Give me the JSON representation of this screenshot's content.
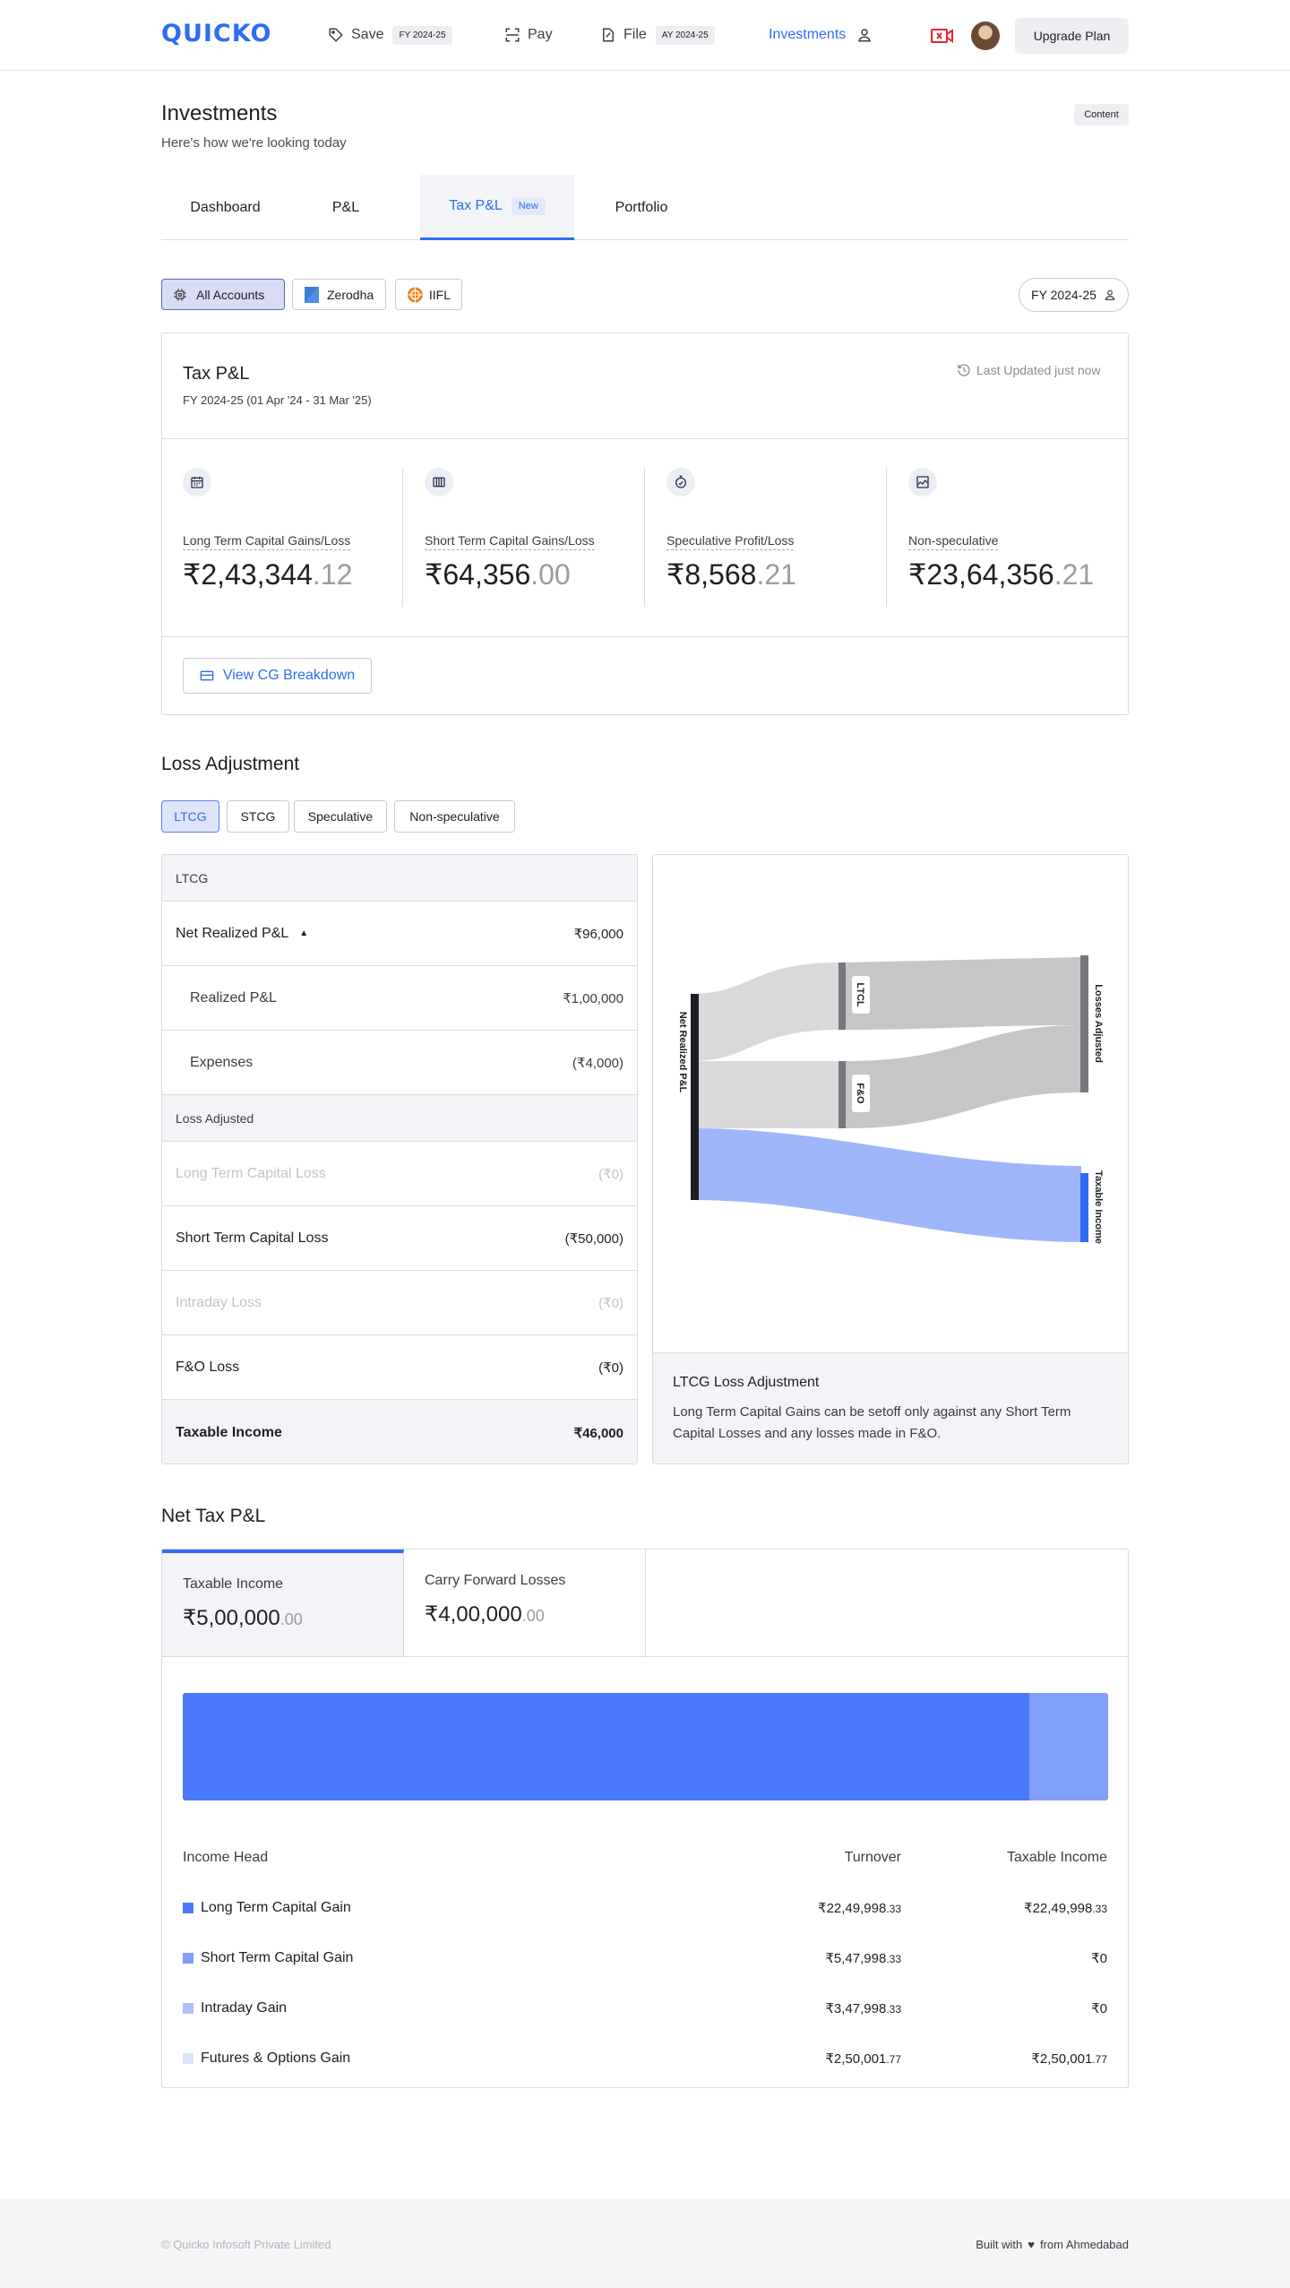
{
  "header": {
    "logo": "QUICKO",
    "nav": [
      {
        "label": "Save",
        "chip": "FY 2024-25"
      },
      {
        "label": "Pay"
      },
      {
        "label": "File",
        "chip": "AY 2024-25"
      },
      {
        "label": "Investments"
      }
    ],
    "upgrade_label": "Upgrade Plan"
  },
  "page": {
    "title": "Investments",
    "subtitle": "Here's how we're looking today",
    "content_badge": "Content"
  },
  "tabs": [
    {
      "label": "Dashboard"
    },
    {
      "label": "P&L"
    },
    {
      "label": "Tax P&L",
      "badge": "New",
      "active": true
    },
    {
      "label": "Portfolio"
    }
  ],
  "accounts": {
    "items": [
      "All Accounts",
      "Zerodha",
      "IIFL"
    ],
    "selected": "All Accounts",
    "fy_label": "FY 2024-25"
  },
  "tax_pl": {
    "title": "Tax P&L",
    "period": "FY 2024-25 (01 Apr '24 - 31 Mar '25)",
    "last_updated": "Last Updated just now",
    "stats": [
      {
        "label": "Long Term Capital Gains/Loss",
        "int": "₹2,43,344",
        "dec": ".12",
        "icon": "calendar-icon"
      },
      {
        "label": "Short Term Capital Gains/Loss",
        "int": "₹64,356",
        "dec": ".00",
        "icon": "columns-icon"
      },
      {
        "label": "Speculative Profit/Loss",
        "int": "₹8,568",
        "dec": ".21",
        "icon": "stopwatch-icon"
      },
      {
        "label": "Non-speculative",
        "int": "₹23,64,356",
        "dec": ".21",
        "icon": "chart-image-icon"
      }
    ],
    "cg_button": "View CG Breakdown"
  },
  "loss_adjustment": {
    "title": "Loss Adjustment",
    "filters": [
      "LTCG",
      "STCG",
      "Speculative",
      "Non-speculative"
    ],
    "selected": "LTCG",
    "table": {
      "head": "LTCG",
      "net_label": "Net Realized P&L",
      "net_value": "₹96,000",
      "realized_label": "Realized P&L",
      "realized_value": "₹1,00,000",
      "expenses_label": "Expenses",
      "expenses_value": "(₹4,000)",
      "adjusted_head": "Loss Adjusted",
      "ltcl_label": "Long Term Capital Loss",
      "ltcl_value": "(₹0)",
      "stcl_label": "Short Term Capital Loss",
      "stcl_value": "(₹50,000)",
      "intraday_label": "Intraday Loss",
      "intraday_value": "(₹0)",
      "fno_label": "F&O Loss",
      "fno_value": "(₹0)",
      "taxable_label": "Taxable Income",
      "taxable_value": "₹46,000"
    },
    "sankey": {
      "nodes": {
        "net": "Net Realized P&L",
        "ltcl": "LTCL",
        "fno": "F&O",
        "losses": "Losses Adjusted",
        "taxable": "Taxable Income"
      }
    },
    "note_title": "LTCG Loss Adjustment",
    "note_text": "Long Term Capital Gains can be setoff only against any Short Term Capital Losses and any losses made in F&O."
  },
  "net_tax": {
    "title": "Net Tax P&L",
    "tabs": [
      {
        "label": "Taxable Income",
        "int": "₹5,00,000",
        "dec": ".00"
      },
      {
        "label": "Carry Forward Losses",
        "int": "₹4,00,000",
        "dec": ".00"
      }
    ],
    "bar": {
      "primary_share": 0.915,
      "primary_color": "#4a79fb",
      "secondary_color": "#809ffb"
    },
    "columns": [
      "Income Head",
      "Turnover",
      "Taxable Income"
    ],
    "rows": [
      {
        "head": "Long Term Capital Gain",
        "turnover": "₹22,49,998",
        "turnover_dec": ".33",
        "taxable": "₹22,49,998",
        "taxable_dec": ".33",
        "color": "#4a79fb"
      },
      {
        "head": "Short Term Capital Gain",
        "turnover": "₹5,47,998",
        "turnover_dec": ".33",
        "taxable": "₹0",
        "taxable_dec": "",
        "color": "#7f9ffb"
      },
      {
        "head": "Intraday Gain",
        "turnover": "₹3,47,998",
        "turnover_dec": ".33",
        "taxable": "₹0",
        "taxable_dec": "",
        "color": "#aebffb"
      },
      {
        "head": "Futures & Options Gain",
        "turnover": "₹2,50,001",
        "turnover_dec": ".77",
        "taxable": "₹2,50,001",
        "taxable_dec": ".77",
        "color": "#dce4fc"
      }
    ]
  },
  "footer": {
    "copyright": "© Quicko Infosoft Private Limited",
    "built_with": "Built with",
    "from": "from Ahmedabad"
  }
}
